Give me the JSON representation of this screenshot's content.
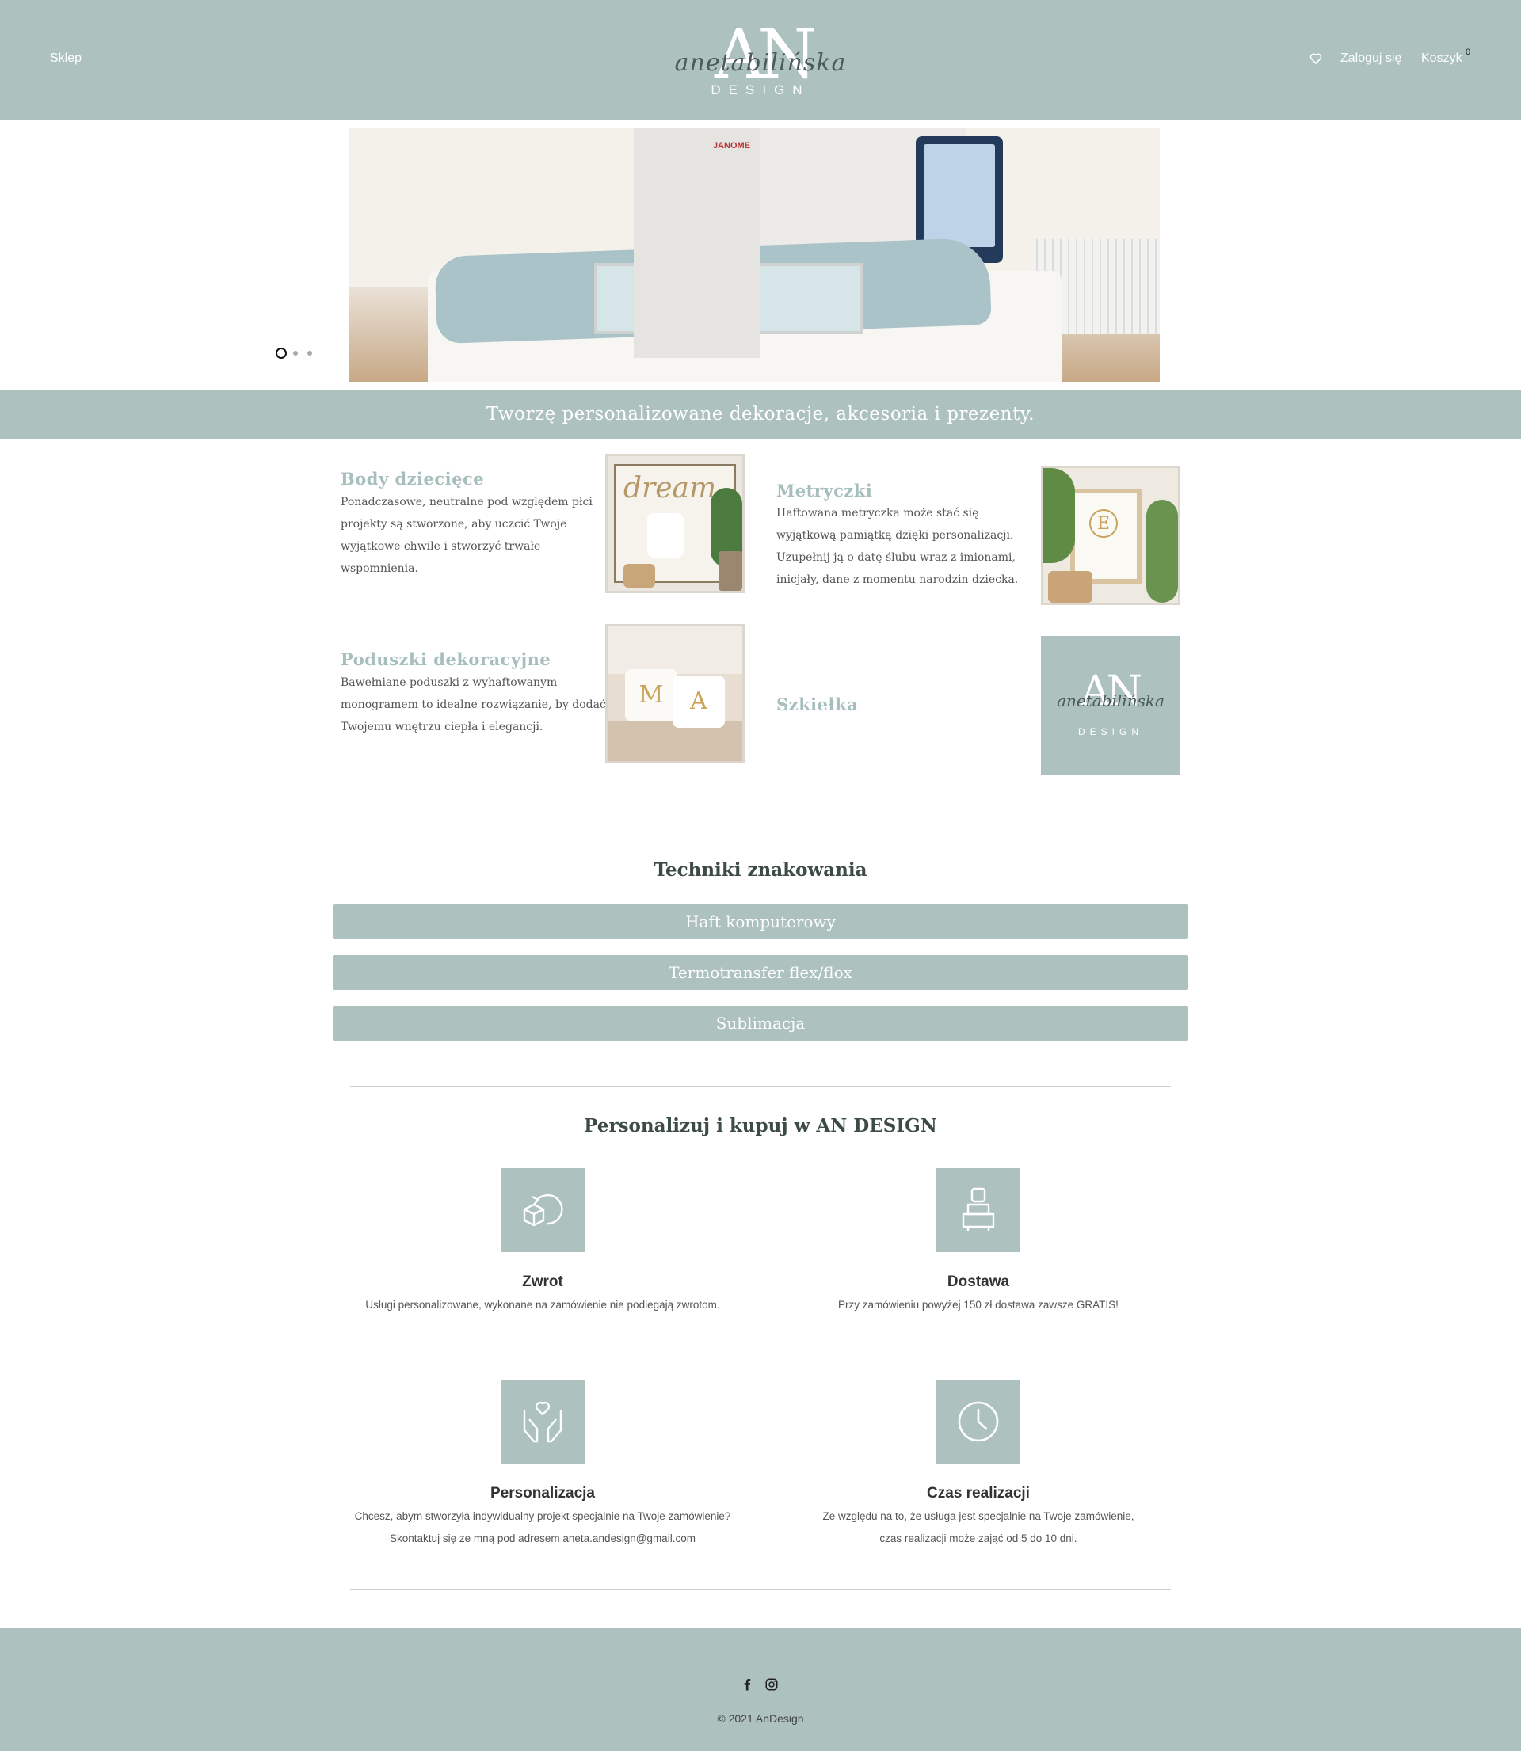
{
  "header": {
    "shop_label": "Sklep",
    "logo_letters": "AN",
    "logo_script": "anetabilińska",
    "logo_design": "DESIGN",
    "login_label": "Zaloguj się",
    "cart_label": "Koszyk",
    "cart_count": "0",
    "wishlist_icon": "heart-icon"
  },
  "hero": {
    "brand_on_machine": "JANOME",
    "slides_total": 3,
    "active_slide": 1
  },
  "tagline": "Tworzę personalizowane dekoracje, akcesoria i prezenty.",
  "categories": [
    {
      "title": "Body dziecięce",
      "desc": "Ponadczasowe, neutralne pod względem płci projekty są stworzone, aby uczcić Twoje wyjątkowe chwile i stworzyć trwałe wspomnienia."
    },
    {
      "title": "Metryczki",
      "desc": "Haftowana metryczka może stać się wyjątkową pamiątką dzięki personalizacji. Uzupełnij ją o datę ślubu wraz z imionami, inicjały, dane z momentu narodzin dziecka."
    },
    {
      "title": "Poduszki dekoracyjne",
      "desc": "Bawełniane poduszki z wyhaftowanym monogramem to idealne rozwiązanie, by dodać Twojemu wnętrzu ciepła i elegancji."
    },
    {
      "title": "Szkiełka",
      "desc": ""
    }
  ],
  "thumb_text": {
    "dream": "dream",
    "frame_letter": "E",
    "pillow_left": "M",
    "pillow_right": "A",
    "logo_letters": "AN",
    "logo_script": "anetabilińska",
    "logo_design": "DESIGN"
  },
  "techniques": {
    "title": "Techniki znakowania",
    "items": [
      "Haft komputerowy",
      "Termotransfer flex/flox",
      "Sublimacja"
    ]
  },
  "features": {
    "title": "Personalizuj i kupuj w AN DESIGN",
    "items": [
      {
        "icon": "return-box-icon",
        "title": "Zwrot",
        "desc": [
          "Usługi personalizowane, wykonane na zamówienie nie podlegają zwrotom."
        ]
      },
      {
        "icon": "delivery-courier-icon",
        "title": "Dostawa",
        "desc": [
          "Przy zamówieniu powyżej 150 zł dostawa zawsze GRATIS!"
        ]
      },
      {
        "icon": "hands-heart-icon",
        "title": "Personalizacja",
        "desc": [
          "Chcesz, abym stworzyła indywidualny projekt specjalnie na Twoje zamówienie?",
          "Skontaktuj się ze mną pod adresem aneta.andesign@gmail.com"
        ]
      },
      {
        "icon": "clock-icon",
        "title": "Czas realizacji",
        "desc": [
          "Ze względu na to, że usługa jest specjalnie na Twoje zamówienie,",
          "czas realizacji może zająć od 5 do 10 dni."
        ]
      }
    ]
  },
  "footer": {
    "social": [
      "facebook-icon",
      "instagram-icon"
    ],
    "copyright": "© 2021 AnDesign"
  },
  "colors": {
    "brand": "#adc1bf",
    "heading_accent": "#a7bfbc"
  }
}
